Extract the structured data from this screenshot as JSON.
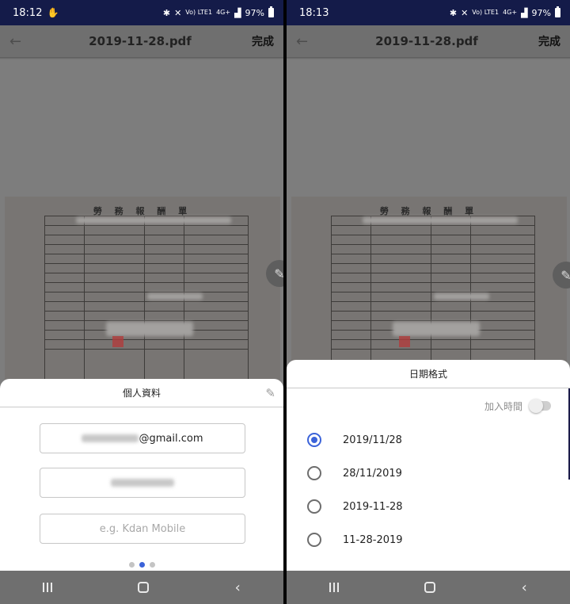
{
  "left": {
    "status": {
      "time": "18:12",
      "battery": "97%",
      "network": "4G+",
      "volte": "Vo) LTE1"
    },
    "toolbar": {
      "title": "2019-11-28.pdf",
      "done": "完成"
    },
    "document": {
      "title": "勞 務 報 酬 單"
    },
    "sheet": {
      "title": "個人資料",
      "email_suffix": "@gmail.com",
      "company_placeholder": "e.g. Kdan Mobile"
    }
  },
  "right": {
    "status": {
      "time": "18:13",
      "battery": "97%",
      "network": "4G+",
      "volte": "Vo) LTE1"
    },
    "toolbar": {
      "title": "2019-11-28.pdf",
      "done": "完成"
    },
    "document": {
      "title": "勞 務 報 酬 單"
    },
    "sheet": {
      "title": "日期格式",
      "toggle_label": "加入時間",
      "toggle_on": false,
      "options": [
        "2019/11/28",
        "28/11/2019",
        "2019-11-28",
        "11-28-2019"
      ],
      "selected_index": 0
    }
  },
  "colors": {
    "accent": "#3b63d9",
    "status_bar": "#141b49"
  }
}
